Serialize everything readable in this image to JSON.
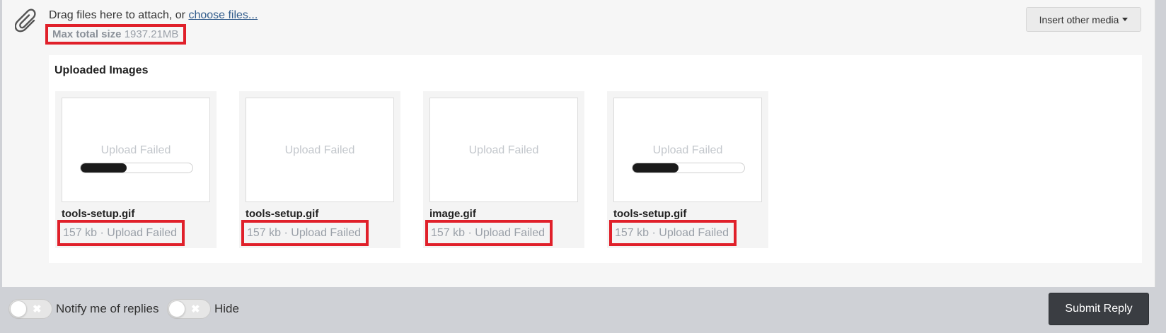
{
  "attach": {
    "drop_text": "Drag files here to attach, or",
    "choose_link": "choose files...",
    "max_size_label": "Max total size",
    "max_size_value": "1937.21MB",
    "insert_media": "Insert other media"
  },
  "uploads": {
    "title": "Uploaded Images",
    "items": [
      {
        "status": "Upload Failed",
        "filename": "tools-setup.gif",
        "meta": "157 kb · Upload Failed",
        "progress": 0.41
      },
      {
        "status": "Upload Failed",
        "filename": "tools-setup.gif",
        "meta": "157 kb · Upload Failed",
        "progress": null
      },
      {
        "status": "Upload Failed",
        "filename": "image.gif",
        "meta": "157 kb · Upload Failed",
        "progress": null
      },
      {
        "status": "Upload Failed",
        "filename": "tools-setup.gif",
        "meta": "157 kb · Upload Failed",
        "progress": 0.41
      }
    ]
  },
  "footer": {
    "notify_label": "Notify me of replies",
    "hide_label": "Hide",
    "submit": "Submit Reply"
  },
  "colors": {
    "highlight": "#e0202a",
    "submit_bg": "#3a3d42"
  },
  "icons": {
    "attach": "paperclip-icon",
    "toggle_off": "x-icon"
  }
}
